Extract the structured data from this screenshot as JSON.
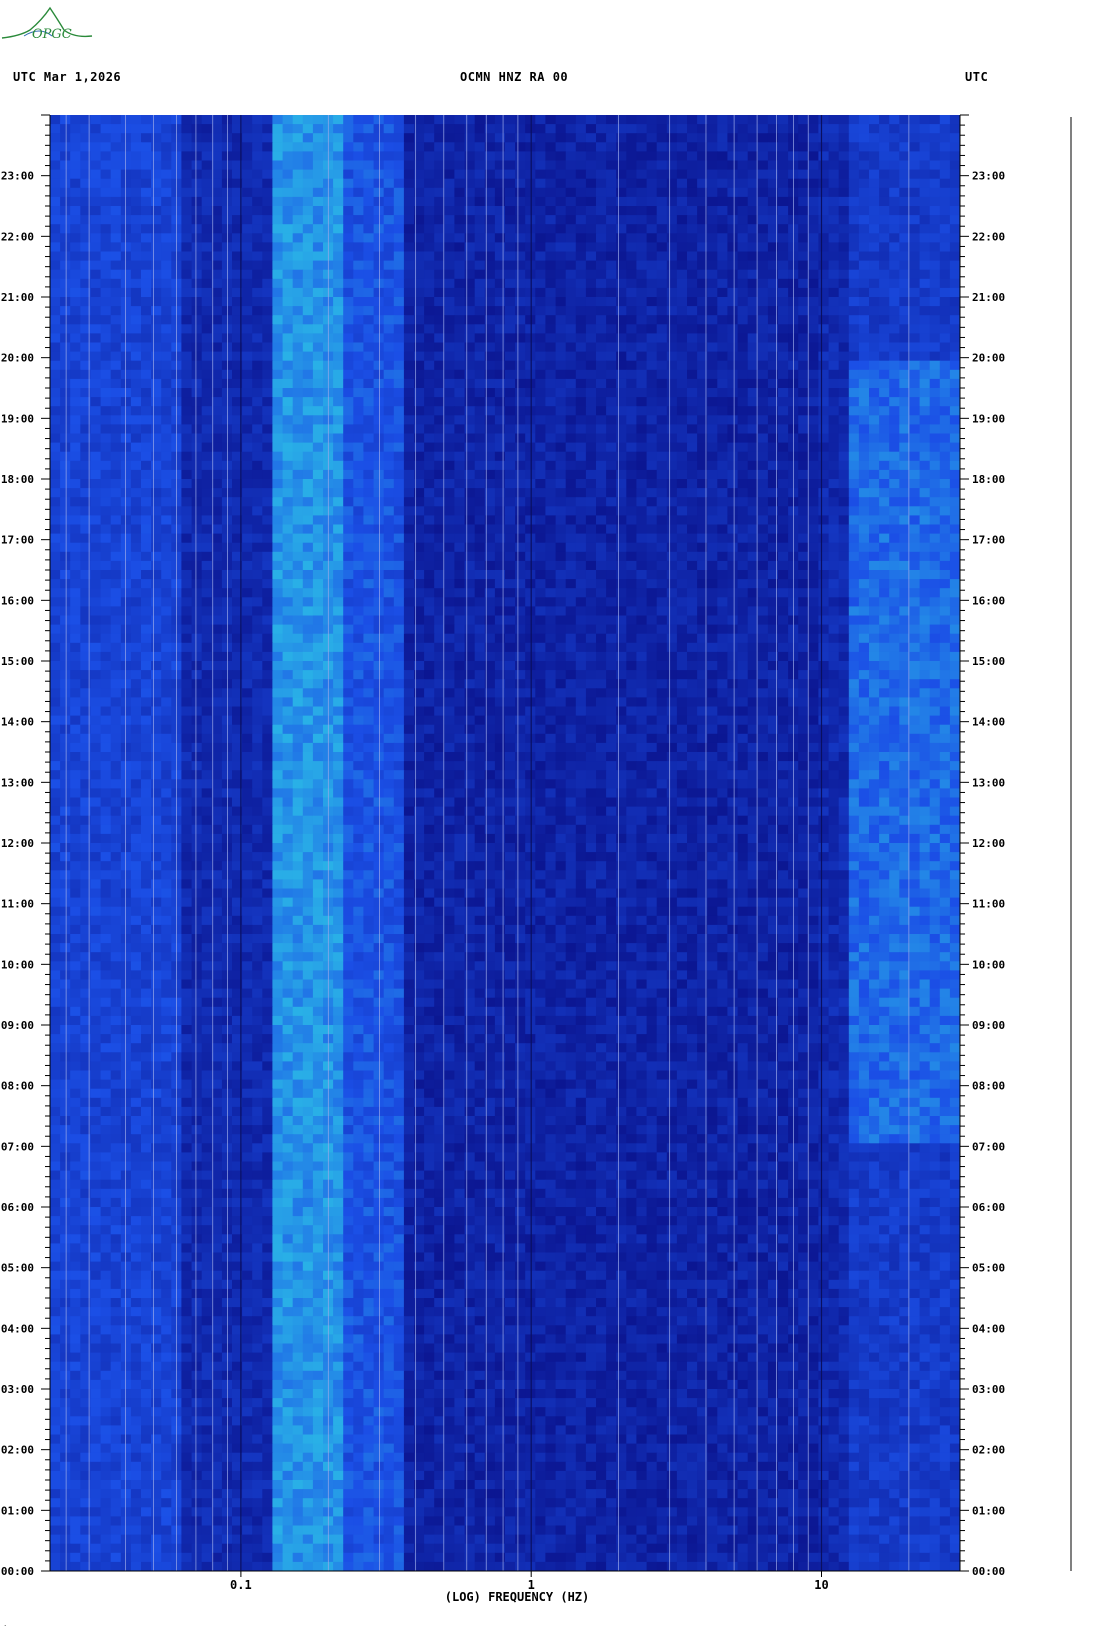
{
  "header": {
    "left": "UTC  Mar 1,2026",
    "center": "OCMN HNZ RA 00",
    "right": "UTC"
  },
  "logo": {
    "text": "OPGC"
  },
  "chart_data": {
    "type": "heatmap",
    "title": "OCMN HNZ RA 00",
    "xlabel": "(LOG) FREQUENCY (HZ)",
    "ylabel": "",
    "x_scale": "log",
    "xlim": [
      0.022,
      30
    ],
    "x_ticks": [
      {
        "value": 0.1,
        "label": "0.1"
      },
      {
        "value": 1,
        "label": "1"
      },
      {
        "value": 10,
        "label": "10"
      }
    ],
    "x_grid_freqs": [
      0.025,
      0.03,
      0.04,
      0.05,
      0.06,
      0.07,
      0.08,
      0.09,
      0.1,
      0.2,
      0.3,
      0.4,
      0.5,
      0.6,
      0.7,
      0.8,
      0.9,
      1,
      2,
      3,
      4,
      5,
      6,
      7,
      8,
      9,
      10,
      20
    ],
    "ylim": [
      0,
      24
    ],
    "y_unit": "hours UTC",
    "y_ticks": [
      {
        "value": 0,
        "label": "00:00"
      },
      {
        "value": 1,
        "label": "01:00"
      },
      {
        "value": 2,
        "label": "02:00"
      },
      {
        "value": 3,
        "label": "03:00"
      },
      {
        "value": 4,
        "label": "04:00"
      },
      {
        "value": 5,
        "label": "05:00"
      },
      {
        "value": 6,
        "label": "06:00"
      },
      {
        "value": 7,
        "label": "07:00"
      },
      {
        "value": 8,
        "label": "08:00"
      },
      {
        "value": 9,
        "label": "09:00"
      },
      {
        "value": 10,
        "label": "10:00"
      },
      {
        "value": 11,
        "label": "11:00"
      },
      {
        "value": 12,
        "label": "12:00"
      },
      {
        "value": 13,
        "label": "13:00"
      },
      {
        "value": 14,
        "label": "14:00"
      },
      {
        "value": 15,
        "label": "15:00"
      },
      {
        "value": 16,
        "label": "16:00"
      },
      {
        "value": 17,
        "label": "17:00"
      },
      {
        "value": 18,
        "label": "18:00"
      },
      {
        "value": 19,
        "label": "19:00"
      },
      {
        "value": 20,
        "label": "20:00"
      },
      {
        "value": 21,
        "label": "21:00"
      },
      {
        "value": 22,
        "label": "22:00"
      },
      {
        "value": 23,
        "label": "23:00"
      }
    ],
    "colors": {
      "background": "#0a1ea8",
      "low": "#0b1590",
      "mid": "#1b4fe6",
      "high": "#2fd6e8",
      "peak": "#7af0c0"
    },
    "energy_bands": [
      {
        "f_min": 0.13,
        "f_max": 0.22,
        "level": 0.75
      },
      {
        "f_min": 0.22,
        "f_max": 0.35,
        "level": 0.5
      },
      {
        "f_min": 0.022,
        "f_max": 0.06,
        "level": 0.4
      },
      {
        "f_min": 12,
        "f_max": 30,
        "level": 0.6
      }
    ]
  }
}
